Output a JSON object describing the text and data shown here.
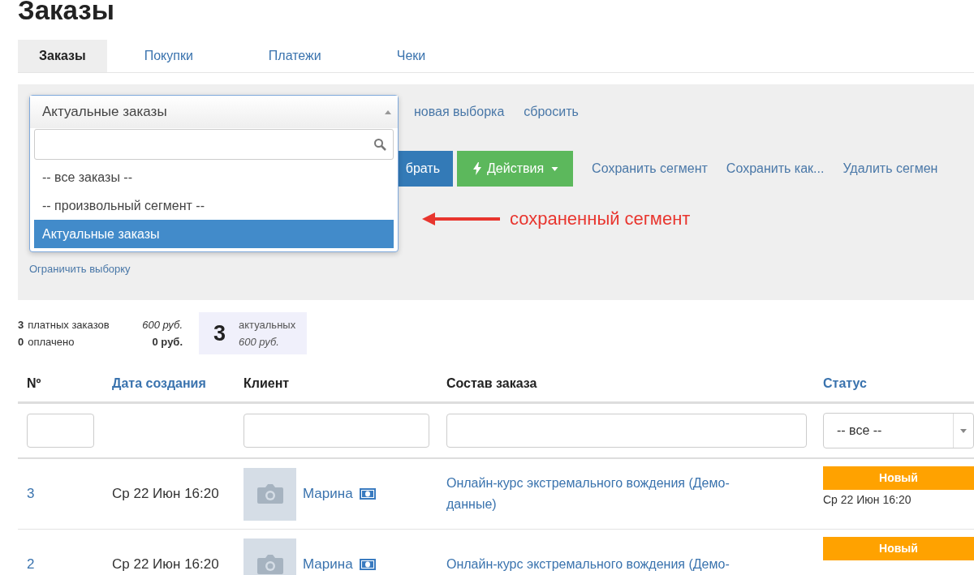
{
  "page_title": "Заказы",
  "tabs": [
    {
      "label": "Заказы",
      "selected": true
    },
    {
      "label": "Покупки",
      "selected": false
    },
    {
      "label": "Платежи",
      "selected": false
    },
    {
      "label": "Чеки",
      "selected": false
    }
  ],
  "segment_select": {
    "value": "Актуальные заказы",
    "expanded": true,
    "options": [
      {
        "label": "-- все заказы --",
        "selected": false
      },
      {
        "label": "-- произвольный сегмент --",
        "selected": false
      },
      {
        "label": "Актуальные заказы",
        "selected": true
      }
    ]
  },
  "segment_links": [
    "новая выборка",
    "сбросить"
  ],
  "buttons": [
    {
      "label": "брать",
      "kind": "primary"
    },
    {
      "label": "Действия",
      "kind": "actions"
    }
  ],
  "segment_actions": [
    "Сохранить сегмент",
    "Сохранить как...",
    "Удалить сегмен"
  ],
  "annotation": "сохраненный сегмент",
  "limit_link": "Ограничить выборку",
  "stats": {
    "lines": [
      {
        "count": "3",
        "label": "платных заказов",
        "sum": "600 руб.",
        "kind": "italic"
      },
      {
        "count": "0",
        "label": "оплачено",
        "sum": "0 руб.",
        "kind": "bold"
      }
    ],
    "highlight": {
      "count": "3",
      "label": "актуальных",
      "sum": "600 руб."
    }
  },
  "table": {
    "columns": [
      {
        "label": "Nº",
        "sortable": false
      },
      {
        "label": "Дата создания",
        "sortable": true
      },
      {
        "label": "Клиент",
        "sortable": false
      },
      {
        "label": "Состав заказа",
        "sortable": false
      },
      {
        "label": "Статус",
        "sortable": true
      }
    ],
    "filters": [
      {
        "kind": "text"
      },
      {
        "kind": "none"
      },
      {
        "kind": "text"
      },
      {
        "kind": "text"
      },
      {
        "kind": "select",
        "value": "-- все --"
      }
    ],
    "rows": [
      {
        "number": "3",
        "date": "Ср 22 Июн 16:20",
        "client": "Марина",
        "content": "Онлайн-курс экстремального вождения (Демо-данные)",
        "status": "Новый",
        "color": "#ffa200",
        "status_date": "Ср 22 Июн 16:20"
      },
      {
        "number": "2",
        "date": "Ср 22 Июн 16:20",
        "client": "Марина",
        "content": "Онлайн-курс экстремального вождения (Демо-",
        "status": "Новый",
        "color": "#ffa200"
      }
    ]
  }
}
